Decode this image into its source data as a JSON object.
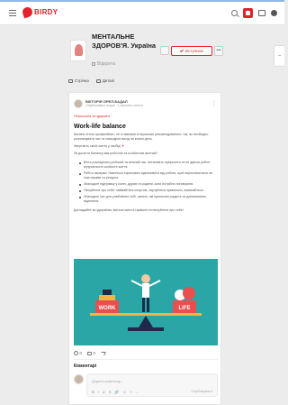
{
  "topbar": {
    "logo_text": "BIRDY",
    "brand_color": "#e2222c",
    "icons": [
      "menu-icon",
      "search-icon",
      "notifications-icon",
      "messages-icon",
      "profile-icon"
    ]
  },
  "group": {
    "title": "МЕНТАЛЬНЕ ЗДОРОВ'Я. Україна",
    "privacy": "Відкрита",
    "joined_label": "Вступили",
    "more_label": "•••"
  },
  "group_tabs": [
    {
      "label": "Стрічка"
    },
    {
      "label": "Деталі"
    }
  ],
  "post": {
    "author": "ВІКТОРІЯ ОРЕЛ-БАДАЛ",
    "meta": "Опубліковано вчора · 1 хвилина читати",
    "menu": "⋮",
    "tag": "Психологія та здоров'я",
    "title": "Work-life balance",
    "paragraphs": [
      "Баланс стиль професійних, не із змінами в персонам рекомендованого: так, як необхідно розпланувати час та знаходити вихід на кожен день.",
      "Звертаєть своїх життя у свобід.",
      "Як досягти балансу між роботою та особистим життям?"
    ],
    "list": [
      "Вчіть розподіляти робочий та вільний час, встановіть пріоритети та не даючи роботі втручатися в особисте життя.",
      "Робіть перерви. Навчіться ефективно відпочивати від роботи, щоб переключитися на інші справи та ресурси.",
      "Знаходьте підтримку у колег, друзів та родини, коли потрібно поговорити.",
      "Піклуйтеся про себе: займайтеся спортом, харчуйтеся правильно, висипайтеся.",
      "Знаходьте час для улюблених хобі, занять, які приносять радість та допомагають відпочити."
    ],
    "closing": "Доглядайте за здоров'ям, вчіться жити в гармонії та піклуйтеся про себе!",
    "illustration_labels": {
      "left": "WORK",
      "right": "LIFE"
    },
    "reactions": [
      {
        "icon": "heart-icon",
        "count": "0"
      },
      {
        "icon": "comment-icon",
        "count": "0"
      },
      {
        "icon": "share-icon",
        "count": ""
      }
    ]
  },
  "comments": {
    "title": "Коментарі",
    "placeholder": "Додати коментар...",
    "toolbar": [
      "B",
      "I",
      "U",
      "S",
      "🔗",
      "☺",
      "+",
      "..."
    ],
    "send_label": "Опублікувати"
  }
}
